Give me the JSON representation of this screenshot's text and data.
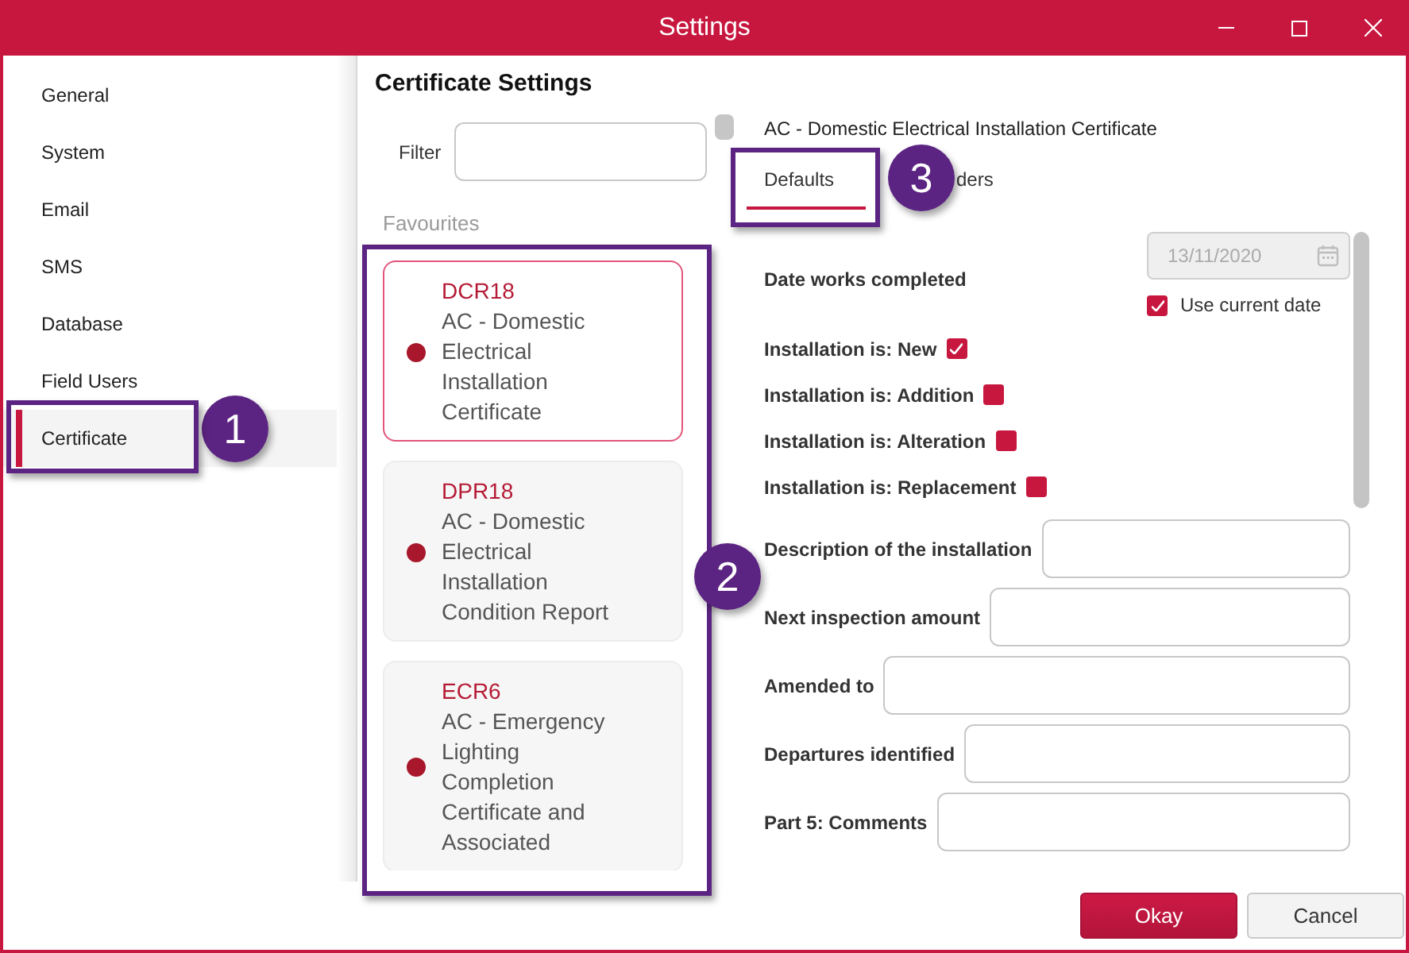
{
  "window": {
    "title": "Settings"
  },
  "sidebar": {
    "items": [
      {
        "label": "General",
        "selected": false
      },
      {
        "label": "System",
        "selected": false
      },
      {
        "label": "Email",
        "selected": false
      },
      {
        "label": "SMS",
        "selected": false
      },
      {
        "label": "Database",
        "selected": false
      },
      {
        "label": "Field Users",
        "selected": false
      },
      {
        "label": "Certificate",
        "selected": true
      }
    ]
  },
  "page": {
    "title": "Certificate Settings"
  },
  "filter": {
    "label": "Filter"
  },
  "favourites": {
    "heading": "Favourites",
    "cards": [
      {
        "code": "DCR18",
        "description": "AC - Domestic Electrical Installation Certificate",
        "selected": true
      },
      {
        "code": "DPR18",
        "description": "AC - Domestic Electrical Installation Condition Report",
        "selected": false
      },
      {
        "code": "ECR6",
        "description": "AC - Emergency Lighting Completion Certificate and Associated",
        "selected": false
      }
    ]
  },
  "certificate": {
    "title": "AC - Domestic Electrical Installation Certificate"
  },
  "tabs": [
    {
      "label": "Defaults",
      "selected": true
    },
    {
      "label": "ders",
      "selected": false
    }
  ],
  "form": {
    "rows": [
      {
        "kind": "date",
        "label": "Date works completed",
        "value": "13/11/2020",
        "disabled": true,
        "option": {
          "label": "Use current date",
          "checked": true
        }
      },
      {
        "kind": "checkbox",
        "label": "Installation is: New",
        "checked": true
      },
      {
        "kind": "checkbox",
        "label": "Installation is: Addition",
        "checked": false
      },
      {
        "kind": "checkbox",
        "label": "Installation is: Alteration",
        "checked": false
      },
      {
        "kind": "checkbox",
        "label": "Installation is: Replacement",
        "checked": false
      },
      {
        "kind": "text",
        "label": "Description of the installation"
      },
      {
        "kind": "text",
        "label": "Next inspection amount"
      },
      {
        "kind": "text",
        "label": "Amended to"
      },
      {
        "kind": "text",
        "label": "Departures identified"
      },
      {
        "kind": "text",
        "label": "Part 5: Comments"
      }
    ]
  },
  "buttons": [
    {
      "label": "Okay",
      "kind": "primary"
    },
    {
      "label": "Cancel",
      "kind": "secondary"
    }
  ],
  "callouts": [
    {
      "number": "1"
    },
    {
      "number": "2"
    },
    {
      "number": "3"
    }
  ]
}
